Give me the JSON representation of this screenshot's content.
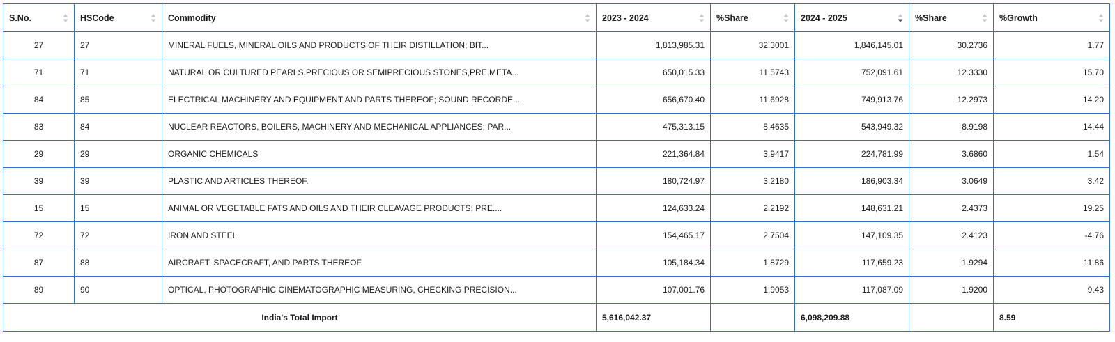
{
  "table": {
    "columns": [
      {
        "label": "S.No.",
        "sort": "none"
      },
      {
        "label": "HSCode",
        "sort": "none"
      },
      {
        "label": "Commodity",
        "sort": "none"
      },
      {
        "label": "2023 - 2024",
        "sort": "none"
      },
      {
        "label": "%Share",
        "sort": "none"
      },
      {
        "label": "2024 - 2025",
        "sort": "desc"
      },
      {
        "label": "%Share",
        "sort": "none"
      },
      {
        "label": "%Growth",
        "sort": "none"
      }
    ],
    "rows": [
      [
        "27",
        "27",
        "MINERAL FUELS, MINERAL OILS AND PRODUCTS OF THEIR DISTILLATION; BIT...",
        "1,813,985.31",
        "32.3001",
        "1,846,145.01",
        "30.2736",
        "1.77"
      ],
      [
        "71",
        "71",
        "NATURAL OR CULTURED PEARLS,PRECIOUS OR SEMIPRECIOUS STONES,PRE.META...",
        "650,015.33",
        "11.5743",
        "752,091.61",
        "12.3330",
        "15.70"
      ],
      [
        "84",
        "85",
        "ELECTRICAL MACHINERY AND EQUIPMENT AND PARTS THEREOF; SOUND RECORDE...",
        "656,670.40",
        "11.6928",
        "749,913.76",
        "12.2973",
        "14.20"
      ],
      [
        "83",
        "84",
        "NUCLEAR REACTORS, BOILERS, MACHINERY AND MECHANICAL APPLIANCES; PAR...",
        "475,313.15",
        "8.4635",
        "543,949.32",
        "8.9198",
        "14.44"
      ],
      [
        "29",
        "29",
        "ORGANIC CHEMICALS",
        "221,364.84",
        "3.9417",
        "224,781.99",
        "3.6860",
        "1.54"
      ],
      [
        "39",
        "39",
        "PLASTIC AND ARTICLES THEREOF.",
        "180,724.97",
        "3.2180",
        "186,903.34",
        "3.0649",
        "3.42"
      ],
      [
        "15",
        "15",
        "ANIMAL OR VEGETABLE FATS AND OILS AND THEIR CLEAVAGE PRODUCTS; PRE....",
        "124,633.24",
        "2.2192",
        "148,631.21",
        "2.4373",
        "19.25"
      ],
      [
        "72",
        "72",
        "IRON AND STEEL",
        "154,465.17",
        "2.7504",
        "147,109.35",
        "2.4123",
        "-4.76"
      ],
      [
        "87",
        "88",
        "AIRCRAFT, SPACECRAFT, AND PARTS THEREOF.",
        "105,184.34",
        "1.8729",
        "117,659.23",
        "1.9294",
        "11.86"
      ],
      [
        "89",
        "90",
        "OPTICAL, PHOTOGRAPHIC CINEMATOGRAPHIC MEASURING, CHECKING PRECISION...",
        "107,001.76",
        "1.9053",
        "117,087.09",
        "1.9200",
        "9.43"
      ]
    ],
    "footer": {
      "label": "India's Total Import",
      "total_2023_2024": "5,616,042.37",
      "share_2023_2024": "",
      "total_2024_2025": "6,098,209.88",
      "share_2024_2025": "",
      "growth": "8.59"
    },
    "colors": {
      "border": "#2f6fd6",
      "sort_idle": "#c4c8cf",
      "sort_active": "#555a62"
    }
  }
}
